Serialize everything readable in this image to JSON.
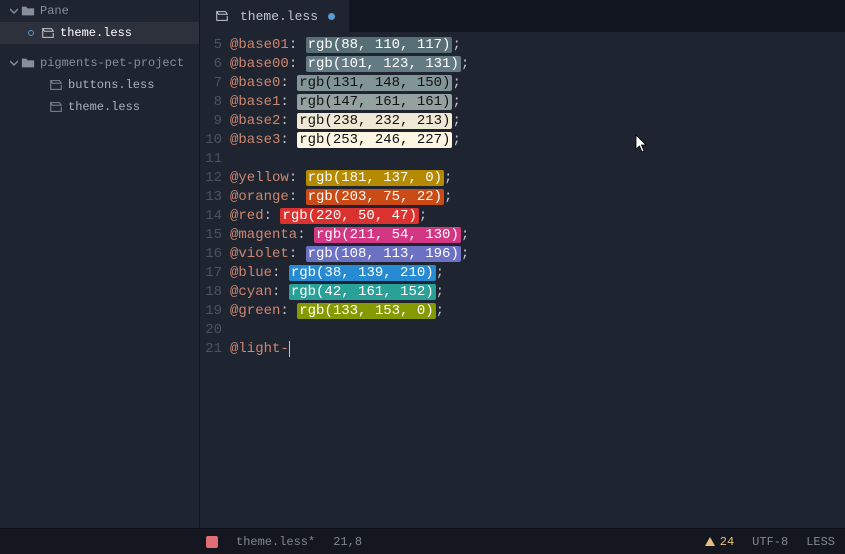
{
  "sidebar": {
    "folder1": {
      "name": "Pane",
      "open_file": "theme.less"
    },
    "folder2": {
      "name": "pigments-pet-project",
      "files": [
        "buttons.less",
        "theme.less"
      ]
    }
  },
  "tab": {
    "label": "theme.less",
    "modified": true
  },
  "code": {
    "lines": [
      {
        "n": 5,
        "var": "@base01",
        "rgb": "rgb(88, 110, 117)",
        "bg": "#586e75",
        "fg": "#fff"
      },
      {
        "n": 6,
        "var": "@base00",
        "rgb": "rgb(101, 123, 131)",
        "bg": "#657b83",
        "fg": "#fff"
      },
      {
        "n": 7,
        "var": "@base0",
        "rgb": "rgb(131, 148, 150)",
        "bg": "#839496",
        "fg": "#111"
      },
      {
        "n": 8,
        "var": "@base1",
        "rgb": "rgb(147, 161, 161)",
        "bg": "#93a1a1",
        "fg": "#111"
      },
      {
        "n": 9,
        "var": "@base2",
        "rgb": "rgb(238, 232, 213)",
        "bg": "#eee8d5",
        "fg": "#111"
      },
      {
        "n": 10,
        "var": "@base3",
        "rgb": "rgb(253, 246, 227)",
        "bg": "#fdf6e3",
        "fg": "#111"
      },
      {
        "n": 11
      },
      {
        "n": 12,
        "var": "@yellow",
        "rgb": "rgb(181, 137, 0)",
        "bg": "#b58900",
        "fg": "#fff"
      },
      {
        "n": 13,
        "var": "@orange",
        "rgb": "rgb(203, 75, 22)",
        "bg": "#cb4b16",
        "fg": "#fff"
      },
      {
        "n": 14,
        "var": "@red",
        "rgb": "rgb(220, 50, 47)",
        "bg": "#dc322f",
        "fg": "#fff"
      },
      {
        "n": 15,
        "var": "@magenta",
        "rgb": "rgb(211, 54, 130)",
        "bg": "#d33682",
        "fg": "#fff"
      },
      {
        "n": 16,
        "var": "@violet",
        "rgb": "rgb(108, 113, 196)",
        "bg": "#6c71c4",
        "fg": "#fff"
      },
      {
        "n": 17,
        "var": "@blue",
        "rgb": "rgb(38, 139, 210)",
        "bg": "#268bd2",
        "fg": "#fff"
      },
      {
        "n": 18,
        "var": "@cyan",
        "rgb": "rgb(42, 161, 152)",
        "bg": "#2aa198",
        "fg": "#fff"
      },
      {
        "n": 19,
        "var": "@green",
        "rgb": "rgb(133, 153, 0)",
        "bg": "#859900",
        "fg": "#fff"
      },
      {
        "n": 20
      },
      {
        "n": 21,
        "raw_var": "@light-"
      }
    ]
  },
  "status": {
    "filename": "theme.less*",
    "cursor": "21,8",
    "warnings": "24",
    "encoding": "UTF-8",
    "language": "LESS"
  }
}
